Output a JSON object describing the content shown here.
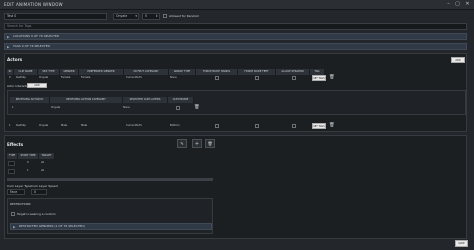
{
  "window": {
    "title": "EDIT ANIMATION WINDOW"
  },
  "top": {
    "name_value": "Test 0",
    "gender_value": "Onyale",
    "stepper_value": "5",
    "allowed_label": "Allowed for Random"
  },
  "search": {
    "placeholder": "Search for Tags"
  },
  "bars": {
    "locations": "LOCATIONS 9 OF 76 SELECTED",
    "tags": "TAGS 0 OF 76 SELECTED"
  },
  "actors": {
    "title": "Actors",
    "add_label": "ADD ACTOR",
    "columns": [
      "ID",
      "CLIP NAME",
      "SEX TYPE",
      "GENDER",
      "PREFERRED GENDER",
      "OUTPUT CATEGORY",
      "RANGE TYPE",
      "FORCE NUDE HANDS",
      "FORCE NUDE FEET",
      "ALLOW STRAPON",
      "TAG"
    ],
    "rows": [
      {
        "id": "0",
        "clip": "testClip",
        "sex": "Onyale",
        "gender": "Female",
        "pref": "Female",
        "cat": "Current3uf4",
        "range": "None",
        "tag_label": "SET TAGS"
      },
      {
        "id": "1",
        "clip": "testClip",
        "sex": "Onyale",
        "gender": "Male",
        "pref": "Male",
        "cat": "Current3uf4",
        "range": "Bottom",
        "tag_label": "SET TAGS"
      }
    ],
    "interaction_label": "Actor Interactions",
    "add_interaction_label": "ADD INTERACTION",
    "sub_columns": [
      "RECEIVING ACTOR ID",
      "RECEIVING ACTION CATEGORY",
      "SELECTED CUM LAYERS",
      "CUM INSIDE"
    ],
    "sub_row": {
      "id": "1",
      "cat": "Onyale",
      "layers": "None"
    }
  },
  "effects": {
    "title": "Effects",
    "columns": [
      "TYPE",
      "START TIME",
      "TARGET"
    ],
    "rows": [
      {
        "type": "",
        "start": "0",
        "target": "all"
      },
      {
        "type": "",
        "start": "1",
        "target": "all"
      }
    ],
    "cum_layer_type_label": "Cum Layer Type",
    "cum_layer_speed_label": "Cum Layer Speed",
    "cum_layer_type_value": "Face",
    "cum_layer_speed_value": "0",
    "restrictions_title": "RESTRICTIONS",
    "restriction_1": "Target is wearing a condom",
    "restriction_2": "RESTRICTED GENDERS (1 OF 76 SELECTED)",
    "save_label": "SAVE"
  }
}
